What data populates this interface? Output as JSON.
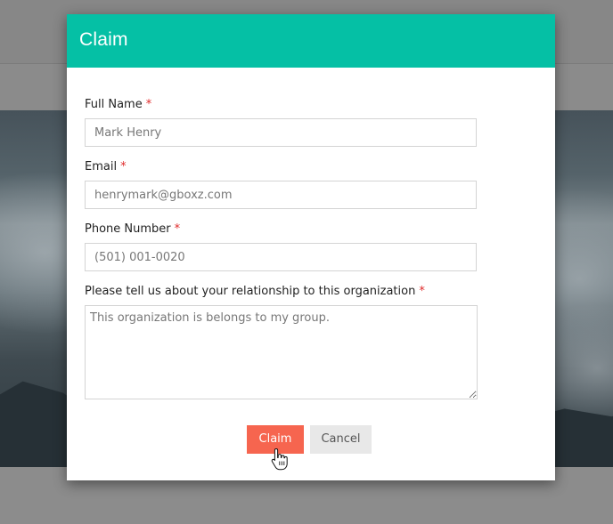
{
  "modal": {
    "title": "Claim",
    "header_color": "#05c0a5"
  },
  "form": {
    "required_marker": "*",
    "full_name": {
      "label": "Full Name",
      "value": "Mark Henry"
    },
    "email": {
      "label": "Email",
      "value": "henrymark@gboxz.com"
    },
    "phone": {
      "label": "Phone Number",
      "value": "(501) 001-0020"
    },
    "relationship": {
      "label": "Please tell us about your relationship to this organization",
      "value": "This organization is belongs to my group."
    }
  },
  "buttons": {
    "claim_label": "Claim",
    "claim_color": "#f6654f",
    "cancel_label": "Cancel"
  },
  "icons": {
    "cursor": "hand-pointer-icon"
  }
}
